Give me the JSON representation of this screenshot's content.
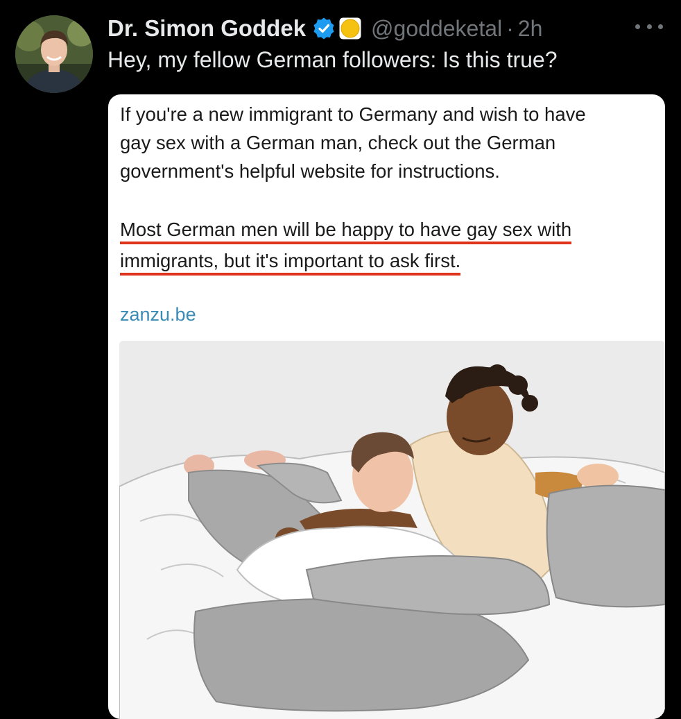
{
  "tweet": {
    "author_name": "Dr. Simon Goddek",
    "handle": "@goddeketal",
    "separator": "·",
    "time": "2h",
    "text": "Hey, my fellow German followers: Is this true?",
    "icons": {
      "avatar": "profile-photo",
      "verified": "verified-badge-icon",
      "extra_badge": "yellow-circle-badge-icon",
      "more": "more-options-icon"
    },
    "colors": {
      "background": "#000000",
      "primary_text": "#e7e9ea",
      "secondary_text": "#71767b",
      "verified_blue": "#1d9bf0",
      "underline_red": "#e0331c",
      "link_blue": "#3a8bb5"
    }
  },
  "media": {
    "paragraph1_line1": "If you're a new immigrant to Germany and wish to have",
    "paragraph1_line2": "gay sex with a German man, check out the German",
    "paragraph1_line3": "government's helpful website for instructions.",
    "paragraph2_line1": "Most German men will be happy to have gay sex with",
    "paragraph2_line2": "immigrants, but it's important to ask first.",
    "link": "zanzu.be",
    "illustration": "illustration-two-men-on-bed"
  }
}
